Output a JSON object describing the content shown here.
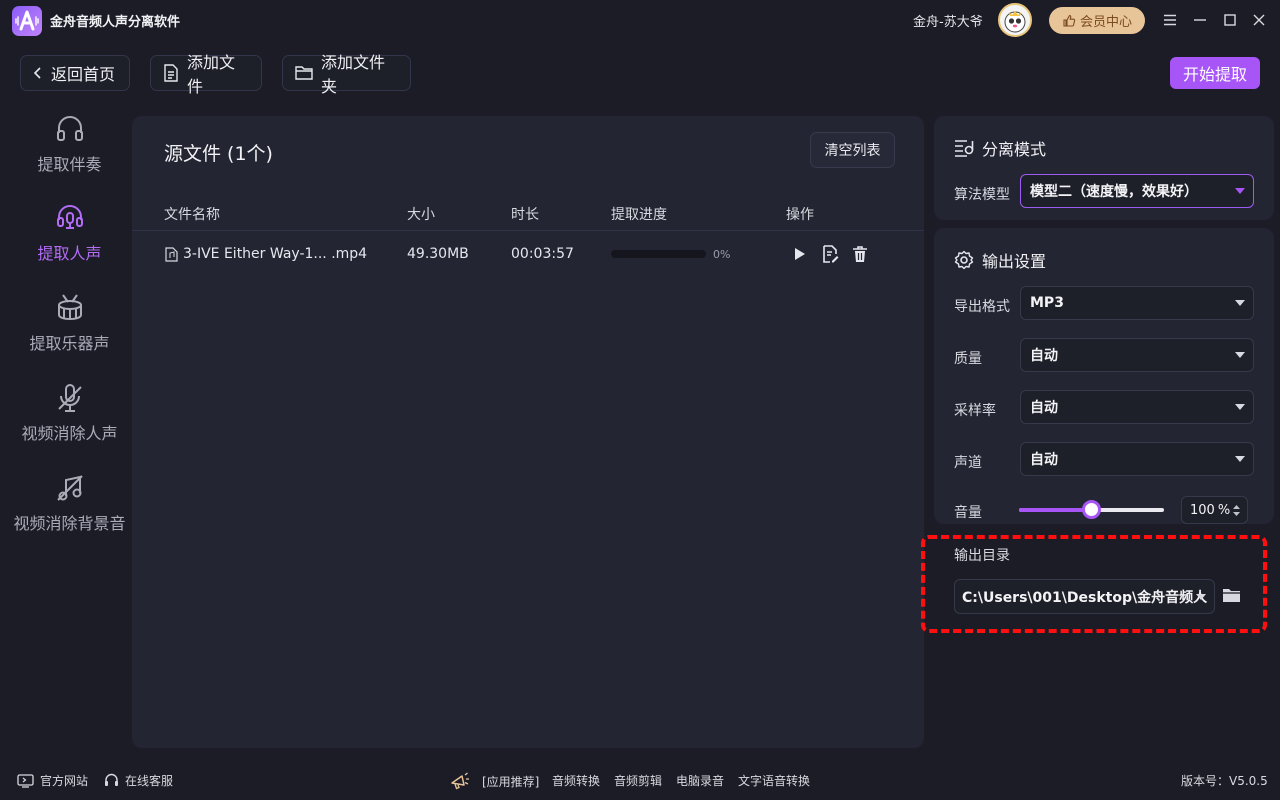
{
  "titlebar": {
    "app_title": "金舟音频人声分离软件",
    "username": "金舟-苏大爷",
    "member_label": "会员中心"
  },
  "toolbar": {
    "back_label": "返回首页",
    "add_file_label": "添加文件",
    "add_folder_label": "添加文件夹",
    "start_label": "开始提取"
  },
  "sidebar": {
    "items": [
      {
        "label": "提取伴奏",
        "icon": "headphones-icon",
        "active": false
      },
      {
        "label": "提取人声",
        "icon": "vocal-headset-icon",
        "active": true
      },
      {
        "label": "提取乐器声",
        "icon": "drum-icon",
        "active": false
      },
      {
        "label": "视频消除人声",
        "icon": "mic-off-icon",
        "active": false
      },
      {
        "label": "视频消除背景音",
        "icon": "music-off-icon",
        "active": false
      }
    ]
  },
  "file_panel": {
    "title": "源文件 (1个)",
    "clear_label": "清空列表",
    "columns": [
      "文件名称",
      "大小",
      "时长",
      "提取进度",
      "操作"
    ],
    "rows": [
      {
        "name": "3-IVE Either Way-1... .mp4",
        "size": "49.30MB",
        "duration": "00:03:57",
        "progress": 0,
        "progress_text": "0%"
      }
    ]
  },
  "separation": {
    "title": "分离模式",
    "model_label": "算法模型",
    "model_value": "模型二（速度慢，效果好）"
  },
  "output": {
    "title": "输出设置",
    "format_label": "导出格式",
    "format_value": "MP3",
    "quality_label": "质量",
    "quality_value": "自动",
    "samplerate_label": "采样率",
    "samplerate_value": "自动",
    "channel_label": "声道",
    "channel_value": "自动",
    "volume_label": "音量",
    "volume_value": "100",
    "volume_unit": "%",
    "volume_fraction": 0.5,
    "dir_label": "输出目录",
    "dir_value": "C:\\Users\\001\\Desktop\\金舟音频人"
  },
  "footer": {
    "website": "官方网站",
    "support": "在线客服",
    "recommend": "[应用推荐]",
    "links": [
      "音频转换",
      "音频剪辑",
      "电脑录音",
      "文字语音转换"
    ],
    "version": "版本号：V5.0.5"
  },
  "colors": {
    "accent": "#a855f7",
    "background": "#1b1c26",
    "panel": "#232532",
    "highlight_dash": "#ff0f0f"
  }
}
